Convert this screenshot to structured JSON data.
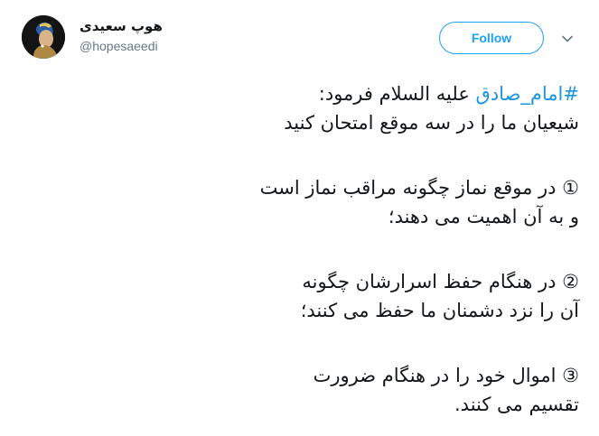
{
  "user": {
    "name": "هوپ سعیدی",
    "handle": "@hopesaeedi"
  },
  "follow_button": {
    "label": "Follow"
  },
  "icons": {
    "caret": "chevron-down-icon",
    "avatar": "avatar-image"
  },
  "colors": {
    "accent": "#1da1f2",
    "hashtag": "#1b95e0",
    "text": "#14171a",
    "muted": "#657786"
  },
  "tweet": {
    "line1_hashtag": "#امام_صادق",
    "line1_rest": " علیه السلام فرمود:",
    "line2": "شیعیان ما را در سه موقع امتحان کنید",
    "line3": "① در موقع نماز چگونه مراقب نماز است",
    "line4": "و به آن اهمیت می دهند؛",
    "line5": "② در هنگام حفظ اسرارشان چگونه",
    "line6": "آن را نزد دشمنان ما حفظ می کنند؛",
    "line7": "③ اموال خود را در هنگام ضرورت",
    "line8": "تقسیم می کنند."
  }
}
